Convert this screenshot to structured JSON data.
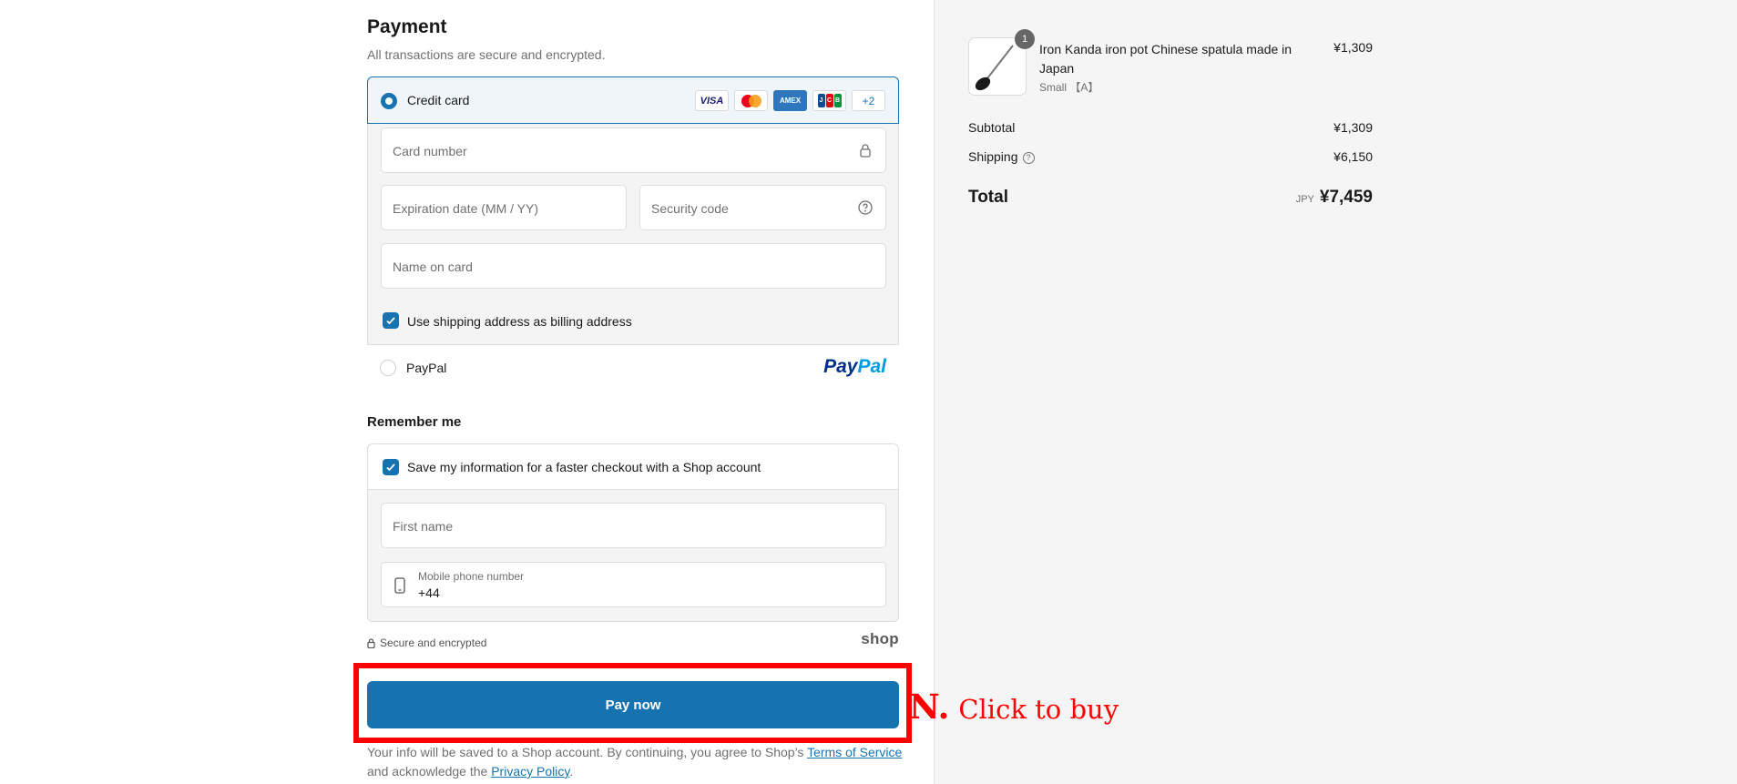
{
  "payment": {
    "title": "Payment",
    "subtitle": "All transactions are secure and encrypted.",
    "credit_card_label": "Credit card",
    "card_brands": [
      "VISA",
      "AMEX",
      "JCB"
    ],
    "more_cards": "+2",
    "card_number_placeholder": "Card number",
    "expiry_placeholder": "Expiration date (MM / YY)",
    "security_code_placeholder": "Security code",
    "name_on_card_placeholder": "Name on card",
    "billing_checkbox_label": "Use shipping address as billing address",
    "paypal_label": "PayPal",
    "paypal_logo_a": "Pay",
    "paypal_logo_b": "Pal"
  },
  "remember": {
    "title": "Remember me",
    "save_label": "Save my information for a faster checkout with a Shop account",
    "first_name_placeholder": "First name",
    "phone_label": "Mobile phone number",
    "phone_value": "+44",
    "secure_text": "Secure and encrypted",
    "shop_logo": "shop"
  },
  "pay_button": "Pay now",
  "annotation": {
    "letter": "N.",
    "text": "Click to buy"
  },
  "legal": {
    "text_1": "Your info will be saved to a Shop account. By continuing, you agree to Shop’s ",
    "terms_link": "Terms of Service",
    "text_2": "and acknowledge the ",
    "privacy_link": "Privacy Policy",
    "text_3": "."
  },
  "summary": {
    "item_qty": "1",
    "item_name": "Iron Kanda iron pot Chinese spatula   made in Japan",
    "item_variant": "Small 【A】",
    "item_price": "¥1,309",
    "subtotal_label": "Subtotal",
    "subtotal_value": "¥1,309",
    "shipping_label": "Shipping",
    "shipping_value": "¥6,150",
    "total_label": "Total",
    "currency": "JPY",
    "total_value": "¥7,459"
  },
  "colors": {
    "accent": "#1773b0",
    "annotation": "#ff0000",
    "summary_bg": "#f5f5f5"
  }
}
